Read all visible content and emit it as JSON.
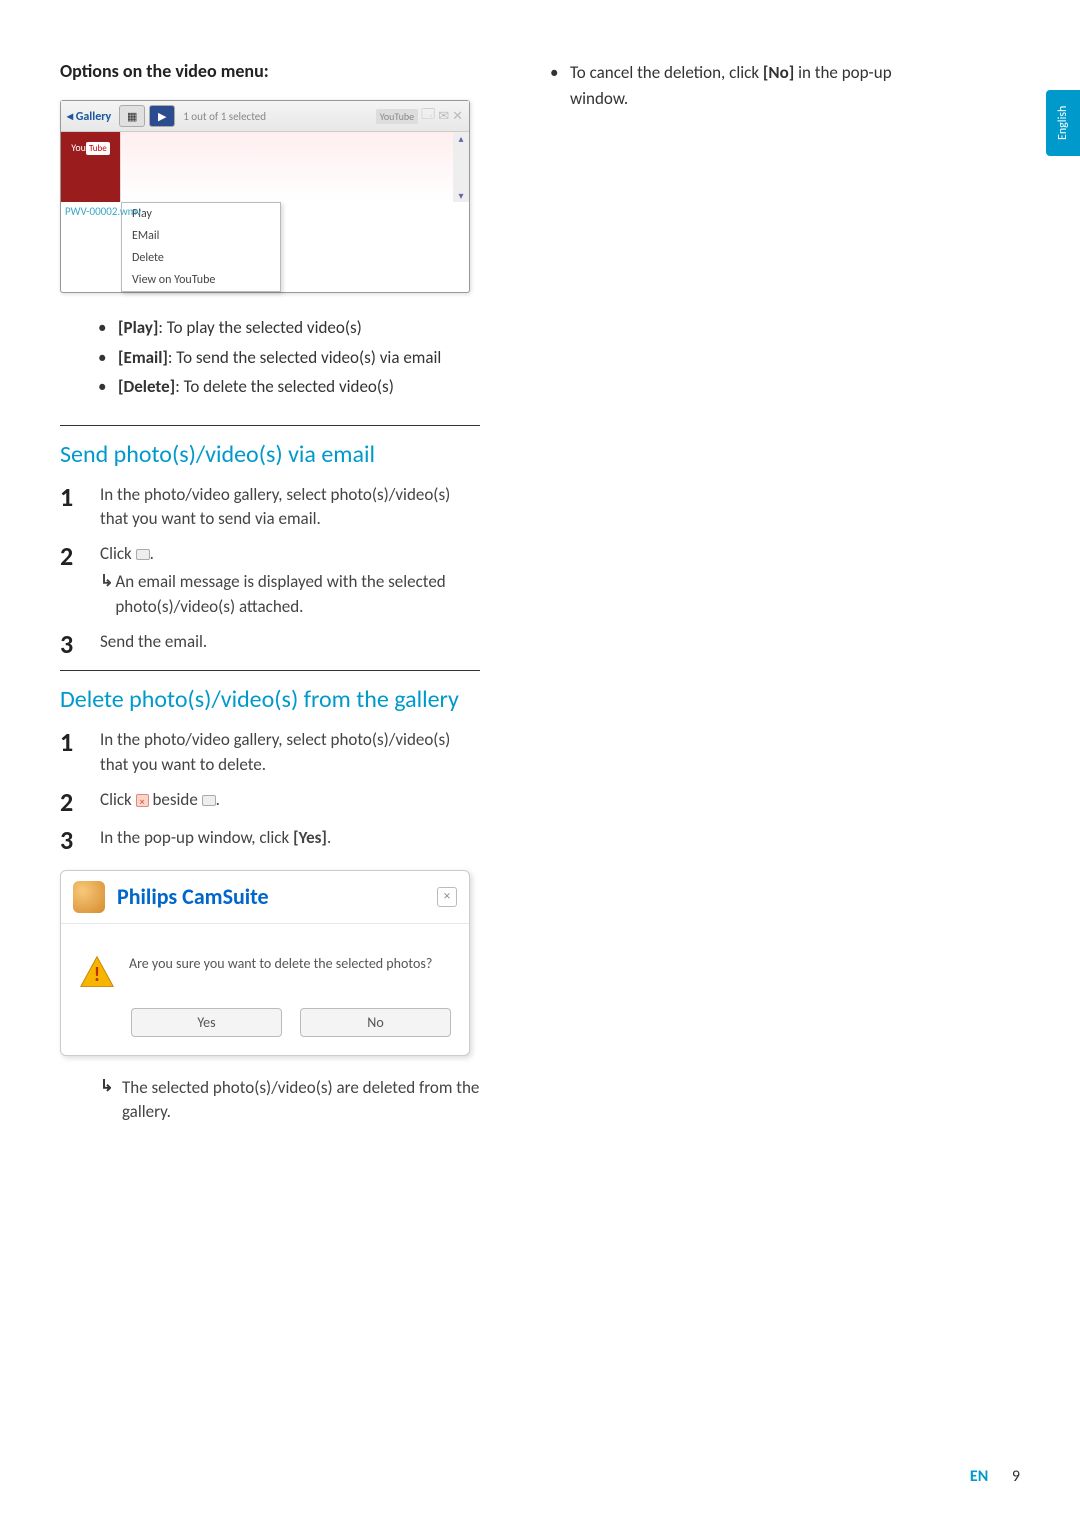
{
  "lang_tab": "English",
  "options_heading": "Options on the video menu:",
  "ss1": {
    "gallery_label": "◂ Gallery",
    "count": "1 out of 1 selected",
    "youtube": "YouTube",
    "thumb_label": "You",
    "thumb_yt": "Tube",
    "filename": "PWV-00002.wmv",
    "menu": [
      "Play",
      "EMail",
      "Delete",
      "View on YouTube"
    ]
  },
  "options_list": [
    {
      "label": "[Play]",
      "desc": ": To play the selected video(s)"
    },
    {
      "label": "[Email]",
      "desc": ": To send the selected video(s) via email"
    },
    {
      "label": "[Delete]",
      "desc": ": To delete the selected video(s)"
    }
  ],
  "email_section": {
    "title": "Send photo(s)/video(s) via email",
    "steps": [
      {
        "num": "1",
        "body": "In the photo/video gallery, select photo(s)/video(s) that you want to send via email."
      },
      {
        "num": "2",
        "body": "Click ",
        "icon": "email",
        "after": ".",
        "result": "An email message is displayed with the selected photo(s)/video(s) attached."
      },
      {
        "num": "3",
        "body": "Send the email."
      }
    ]
  },
  "delete_section": {
    "title": "Delete photo(s)/video(s) from the gallery",
    "steps": [
      {
        "num": "1",
        "body": "In the photo/video gallery, select photo(s)/video(s) that you want to delete."
      },
      {
        "num": "2",
        "body": "Click ",
        "icon1": "x",
        "mid": " beside ",
        "icon2": "email",
        "after": "."
      },
      {
        "num": "3",
        "body": "In the pop-up window, click ",
        "bold": "[Yes]",
        "after": "."
      }
    ],
    "result": "The selected photo(s)/video(s) are deleted from the gallery."
  },
  "dialog": {
    "title": "Philips CamSuite",
    "message": "Are you sure you want to delete the selected photos?",
    "yes": "Yes",
    "no": "No"
  },
  "right_col": {
    "cancel_text": "To cancel the deletion, click ",
    "cancel_bold": "[No]",
    "cancel_after": " in the pop-up window."
  },
  "footer": {
    "en": "EN",
    "page": "9"
  }
}
